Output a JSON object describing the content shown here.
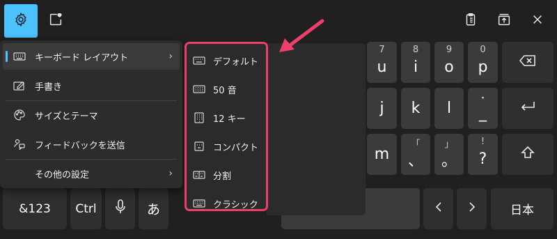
{
  "toolbar": {
    "settings_icon": "gear-icon",
    "emoji_icon": "emoji-heart-icon",
    "clipboard_icon": "clipboard-icon",
    "dock_icon": "dock-icon",
    "close_icon": "close-icon",
    "accent_color": "#4cc2ff"
  },
  "menu": {
    "items": [
      {
        "label": "キーボード レイアウト",
        "icon": "keyboard-icon",
        "has_submenu": true,
        "selected": true
      },
      {
        "label": "手書き",
        "icon": "handwriting-icon"
      },
      {
        "label": "サイズとテーマ",
        "icon": "palette-icon"
      },
      {
        "label": "フィードバックを送信",
        "icon": "feedback-icon"
      },
      {
        "label": "その他の設定",
        "has_submenu": true
      }
    ]
  },
  "submenu": {
    "highlight_color": "#ee3e6b",
    "items": [
      {
        "label": "デフォルト",
        "icon": "keyboard-default-icon"
      },
      {
        "label": "50 音",
        "icon": "keyboard-50on-icon"
      },
      {
        "label": "12 キー",
        "icon": "keyboard-12key-icon"
      },
      {
        "label": "コンパクト",
        "icon": "keyboard-compact-icon"
      },
      {
        "label": "分割",
        "icon": "keyboard-split-icon"
      },
      {
        "label": "クラシック",
        "icon": "keyboard-classic-icon"
      }
    ]
  },
  "keys": {
    "u": {
      "hint": "7",
      "main": "u"
    },
    "i": {
      "hint": "8",
      "main": "i"
    },
    "o": {
      "hint": "9",
      "main": "o"
    },
    "p": {
      "hint": "0",
      "main": "p"
    },
    "j": {
      "main": "j"
    },
    "k": {
      "main": "k"
    },
    "l": {
      "main": "l"
    },
    "underscore": {
      "hint": "・",
      "main": "_"
    },
    "m": {
      "main": "m"
    },
    "comma": {
      "hint": "「",
      "main": "、"
    },
    "period": {
      "hint": "」",
      "main": "。"
    },
    "question": {
      "hint": "!",
      "main": "?"
    },
    "sym": {
      "label": "&123"
    },
    "ctrl": {
      "label": "Ctrl"
    },
    "a": {
      "label": "あ"
    },
    "lang": {
      "label": "日本"
    }
  },
  "annotation": {
    "arrow_color": "#ee3e6b"
  }
}
